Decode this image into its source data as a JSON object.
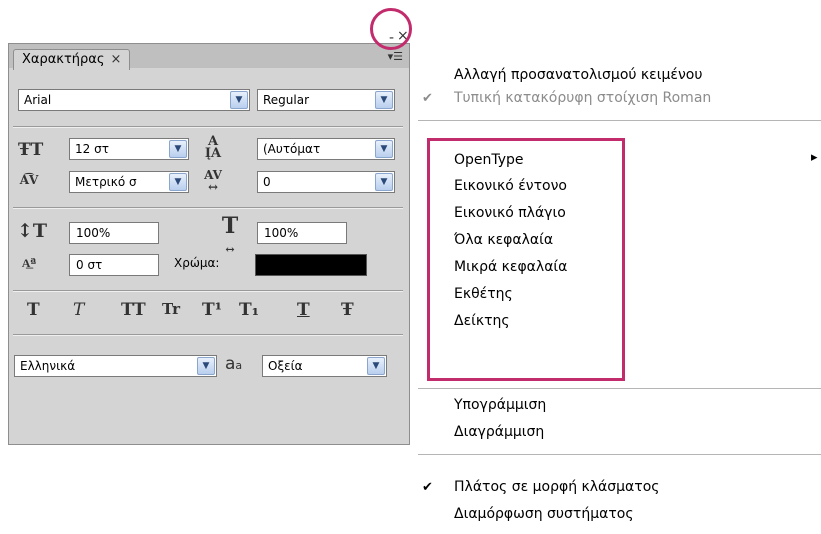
{
  "panel": {
    "tab_label": "Χαρακτήρας",
    "tab_close": "×",
    "menu_icon": "panel-menu-icon",
    "font_family": "Arial",
    "font_style": "Regular",
    "size": "12 στ",
    "leading": "(Αυτόματ",
    "kerning": "Μετρικό σ",
    "tracking": "0",
    "vertical_scale": "100%",
    "horizontal_scale": "100%",
    "baseline_shift": "0 στ",
    "color_label": "Χρώμα:",
    "color_value": "#000000",
    "style_buttons": [
      "T",
      "T",
      "TT",
      "Tr",
      "T¹",
      "T₁",
      "T",
      "Ŧ"
    ],
    "language": "Ελληνικά",
    "antialias_icon_text": "a",
    "antialias_icon_sub": "a",
    "antialias": "Οξεία"
  },
  "window_controls": {
    "minimize": "-",
    "close": "×"
  },
  "menu": {
    "items": [
      {
        "label": "Αλλαγή προσανατολισμού κειμένου",
        "disabled": false,
        "checked": false
      },
      {
        "label": "Τυπική κατακόρυφη στοίχιση Roman",
        "disabled": true,
        "checked": true
      },
      {
        "label": "OpenType",
        "disabled": false,
        "checked": false,
        "submenu": true
      },
      {
        "label": "Εικονικό έντονο",
        "disabled": false,
        "checked": false
      },
      {
        "label": "Εικονικό πλάγιο",
        "disabled": false,
        "checked": false
      },
      {
        "label": "Όλα κεφαλαία",
        "disabled": false,
        "checked": false
      },
      {
        "label": "Μικρά κεφαλαία",
        "disabled": false,
        "checked": false
      },
      {
        "label": "Εκθέτης",
        "disabled": false,
        "checked": false
      },
      {
        "label": "Δείκτης",
        "disabled": false,
        "checked": false
      },
      {
        "label": "Υπογράμμιση",
        "disabled": false,
        "checked": false
      },
      {
        "label": "Διαγράμμιση",
        "disabled": false,
        "checked": false
      },
      {
        "label": "Πλάτος σε μορφή κλάσματος",
        "disabled": false,
        "checked": true
      },
      {
        "label": "Διαμόρφωση συστήματος",
        "disabled": false,
        "checked": false
      }
    ],
    "check_glyph": "✔",
    "submenu_arrow": "▸"
  },
  "colors": {
    "highlight": "#c22c6c",
    "panel_bg": "#d4d4d4"
  }
}
